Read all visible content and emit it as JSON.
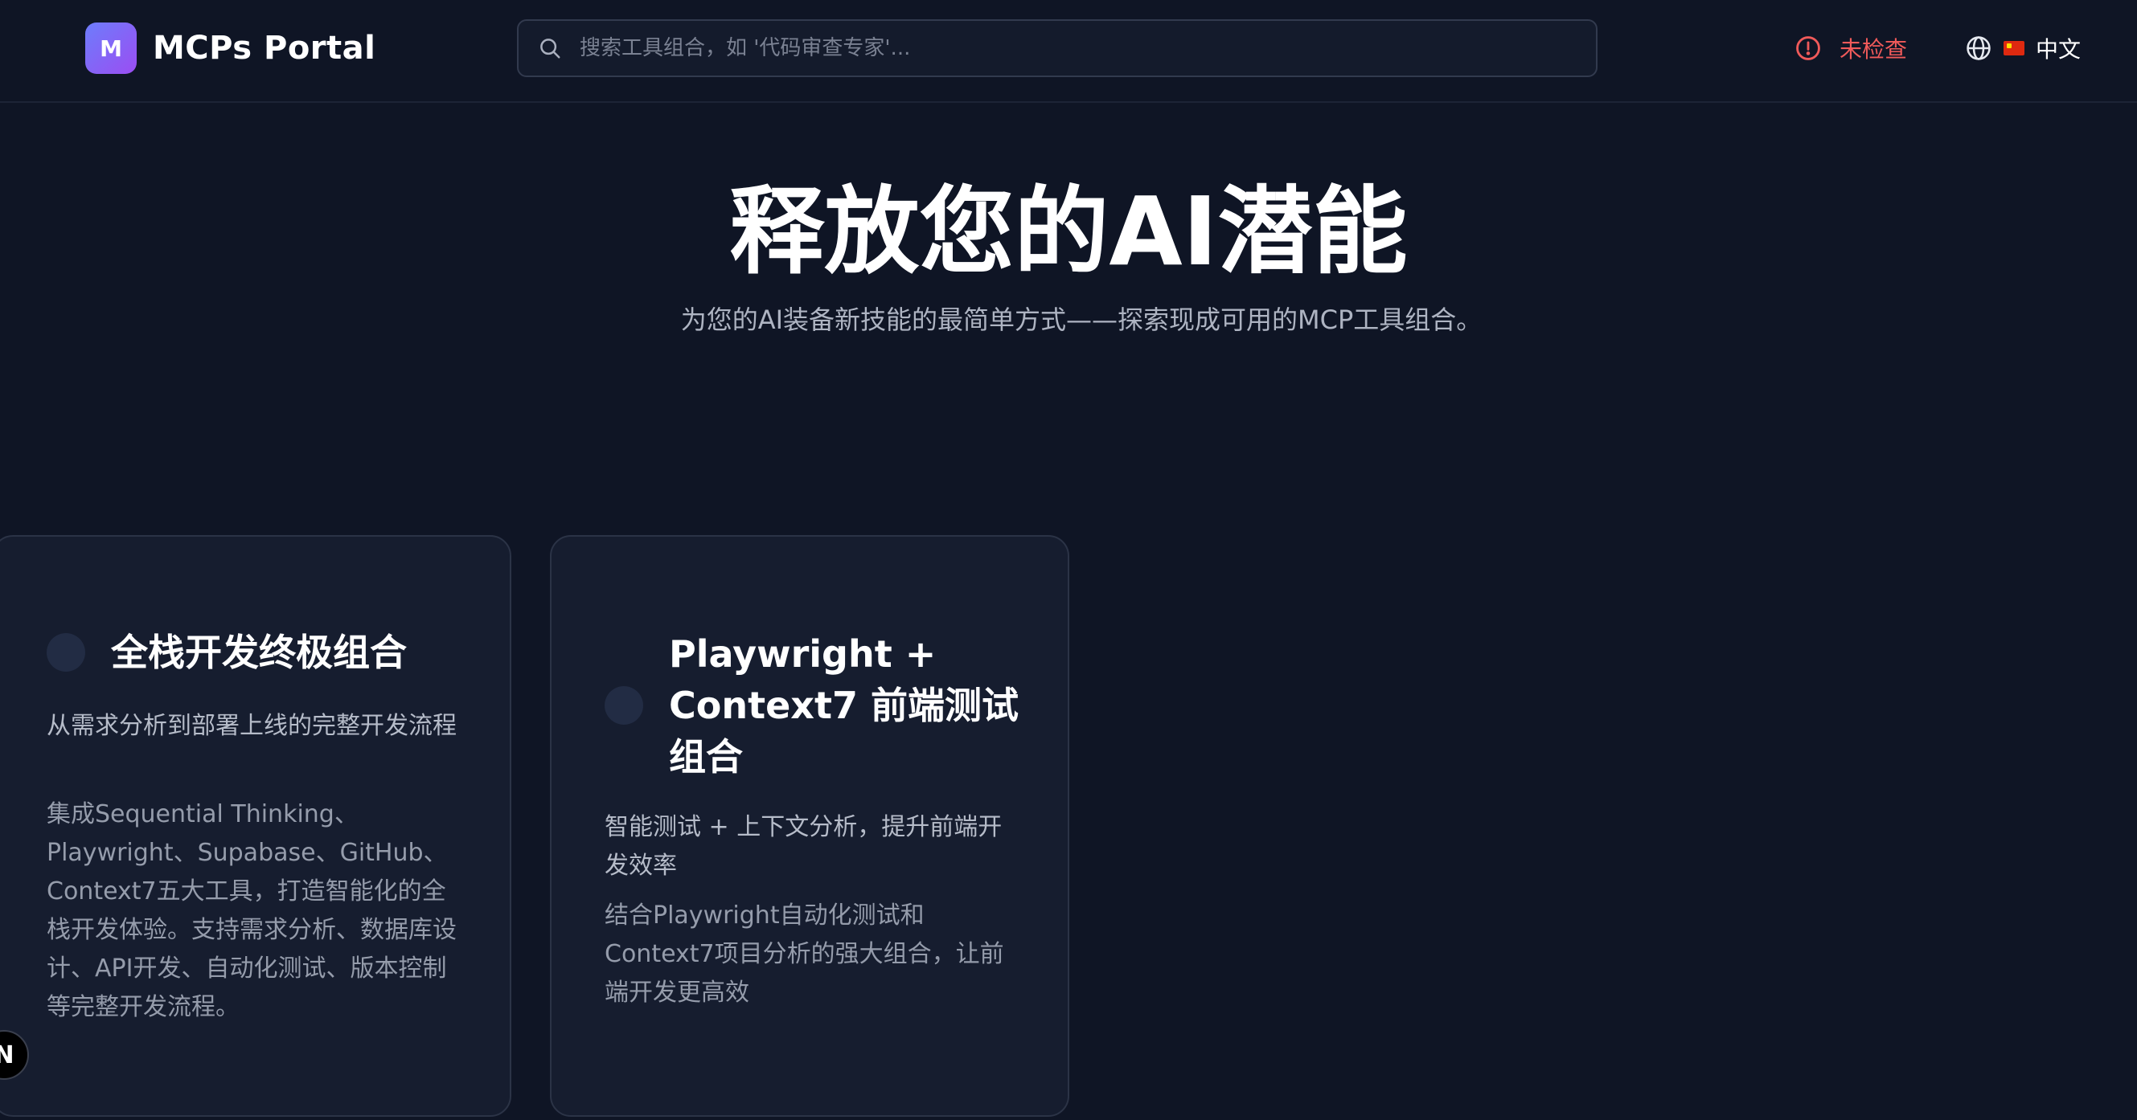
{
  "header": {
    "logo_letter": "M",
    "app_title": "MCPs Portal",
    "search_placeholder": "搜索工具组合，如 '代码审查专家'...",
    "status_label": "未检查",
    "language_label": "中文"
  },
  "hero": {
    "title": "释放您的AI潜能",
    "subtitle": "为您的AI装备新技能的最简单方式——探索现成可用的MCP工具组合。"
  },
  "cards": [
    {
      "title": "全栈开发终极组合",
      "description": "从需求分析到部署上线的完整开发流程",
      "details": "集成Sequential Thinking、Playwright、Supabase、GitHub、Context7五大工具，打造智能化的全栈开发体验。支持需求分析、数据库设计、API开发、自动化测试、版本控制等完整开发流程。"
    },
    {
      "title": "Playwright + Context7 前端测试组合",
      "description": "智能测试 + 上下文分析，提升前端开发效率",
      "details": "结合Playwright自动化测试和Context7项目分析的强大组合，让前端开发更高效"
    }
  ],
  "badge": {
    "letter": "N"
  },
  "colors": {
    "background": "#0f1525",
    "card": "#161d2f",
    "accent_gradient_start": "#6d7dfb",
    "accent_gradient_end": "#9b4df2",
    "status_red": "#f05a5a"
  },
  "icons": {
    "search": "search-icon",
    "status": "alert-circle-icon",
    "language": "globe-icon",
    "flag": "china-flag-icon"
  }
}
